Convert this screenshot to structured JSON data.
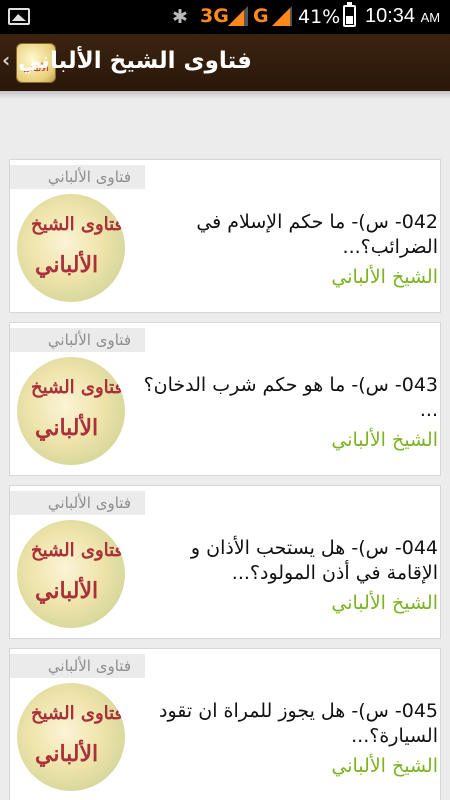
{
  "status_bar": {
    "network1": "3G",
    "network2": "G",
    "battery": "41%",
    "time": "10:34",
    "ampm": "AM"
  },
  "action_bar": {
    "title": "فتاوى الشيخ الألباني",
    "icon_text": "الألباني"
  },
  "cards": [
    {
      "category": "فتاوى الألباني",
      "title": "042- س)- ما حكم الإسلام في الضرائب؟...",
      "author": "الشيخ الألباني",
      "thumb_line1": "فتاوى الشيخ",
      "thumb_line2": "الألباني"
    },
    {
      "category": "فتاوى الألباني",
      "title": "043- س)- ما هو حكم شرب الدخان؟ ...",
      "author": "الشيخ الألباني",
      "thumb_line1": "فتاوى الشيخ",
      "thumb_line2": "الألباني"
    },
    {
      "category": "فتاوى الألباني",
      "title": "044- س)- هل يستحب الأذان و الإقامة في أذن المولود؟...",
      "author": "الشيخ الألباني",
      "thumb_line1": "فتاوى الشيخ",
      "thumb_line2": "الألباني"
    },
    {
      "category": "فتاوى الألباني",
      "title": "045- س)- هل يجوز للمراة ان تقود السيارة؟...",
      "author": "الشيخ الألباني",
      "thumb_line1": "فتاوى الشيخ",
      "thumb_line2": "الألباني"
    }
  ]
}
